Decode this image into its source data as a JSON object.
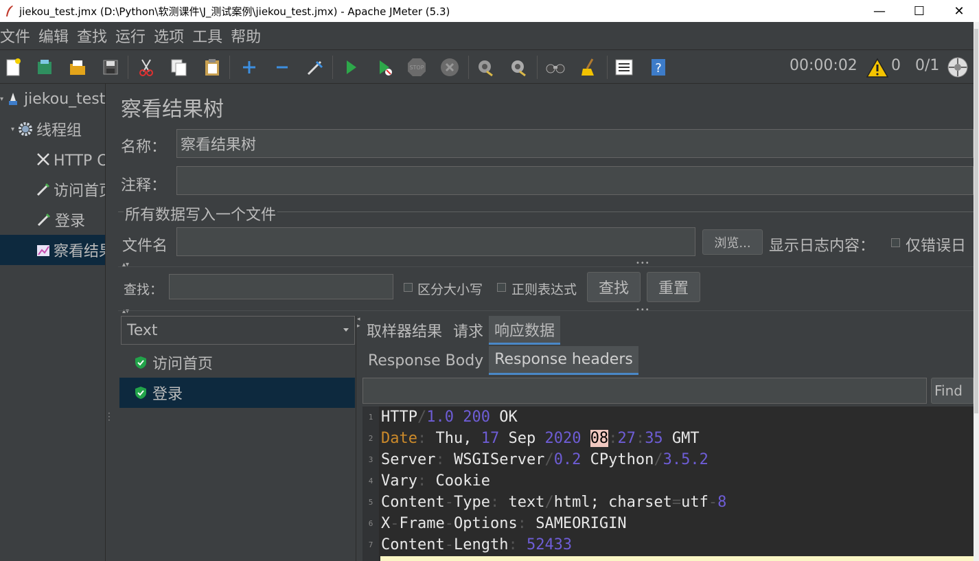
{
  "window": {
    "title": "jiekou_test.jmx (D:\\Python\\软测课件\\J_测试案例\\jiekou_test.jmx) - Apache JMeter (5.3)",
    "minimize": "—",
    "maximize": "☐",
    "close": "✕"
  },
  "menu": [
    "文件",
    "编辑",
    "查找",
    "运行",
    "选项",
    "工具",
    "帮助"
  ],
  "toolbar": {
    "timer": "00:00:02",
    "warnings": "0",
    "threads": "0/1"
  },
  "tree": [
    {
      "label": "jiekou_test",
      "icon": "test-plan-icon"
    },
    {
      "label": "线程组",
      "icon": "gear-icon"
    },
    {
      "label": "HTTP Cookie管理器",
      "icon": "config-tools-icon"
    },
    {
      "label": "访问首页",
      "icon": "sampler-pen-icon"
    },
    {
      "label": "登录",
      "icon": "sampler-pen-icon"
    },
    {
      "label": "察看结果树",
      "icon": "listener-chart-icon",
      "selected": true
    }
  ],
  "panel": {
    "title": "察看结果树",
    "name_label": "名称：",
    "name_value": "察看结果树",
    "comment_label": "注释：",
    "comment_value": "",
    "file_group_label": "所有数据写入一个文件",
    "filename_label": "文件名",
    "filename_value": "",
    "browse_button": "浏览...",
    "log_display_label": "显示日志内容：",
    "errors_only_label": "仅错误日",
    "search_label": "查找：",
    "search_value": "",
    "case_sensitive_label": "区分大小写",
    "regex_label": "正则表达式",
    "find_button": "查找",
    "reset_button": "重置"
  },
  "results": {
    "renderer": "Text",
    "items": [
      {
        "label": "访问首页",
        "status": "success"
      },
      {
        "label": "登录",
        "status": "success",
        "selected": true
      }
    ]
  },
  "tabs": [
    "取样器结果",
    "请求",
    "响应数据"
  ],
  "active_tab": "响应数据",
  "subtabs": [
    "Response Body",
    "Response headers"
  ],
  "active_subtab": "Response headers",
  "find_field_value": "",
  "find_button": "Find",
  "headers": [
    {
      "n": "1",
      "parts": [
        [
          "w",
          "HTTP"
        ],
        [
          "s",
          "/"
        ],
        [
          "p",
          "1.0 200"
        ],
        [
          "w",
          " OK"
        ]
      ]
    },
    {
      "n": "2",
      "parts": [
        [
          "o",
          "Date"
        ],
        [
          "s",
          ":"
        ],
        [
          "w",
          " Thu, "
        ],
        [
          "p",
          "17"
        ],
        [
          "w",
          " Sep "
        ],
        [
          "p",
          "2020"
        ],
        [
          "w",
          " "
        ],
        [
          "h",
          "08"
        ],
        [
          "s",
          ":"
        ],
        [
          "p",
          "27"
        ],
        [
          "s",
          ":"
        ],
        [
          "p",
          "35"
        ],
        [
          "w",
          " GMT"
        ]
      ]
    },
    {
      "n": "3",
      "parts": [
        [
          "w",
          "Server"
        ],
        [
          "s",
          ":"
        ],
        [
          "w",
          " WSGIServer"
        ],
        [
          "s",
          "/"
        ],
        [
          "p",
          "0.2"
        ],
        [
          "w",
          " CPython"
        ],
        [
          "s",
          "/"
        ],
        [
          "p",
          "3.5.2"
        ]
      ]
    },
    {
      "n": "4",
      "parts": [
        [
          "w",
          "Vary"
        ],
        [
          "s",
          ":"
        ],
        [
          "w",
          " Cookie"
        ]
      ]
    },
    {
      "n": "5",
      "parts": [
        [
          "w",
          "Content"
        ],
        [
          "s",
          "-"
        ],
        [
          "w",
          "Type"
        ],
        [
          "s",
          ":"
        ],
        [
          "w",
          " text"
        ],
        [
          "s",
          "/"
        ],
        [
          "w",
          "html; charset"
        ],
        [
          "s",
          "="
        ],
        [
          "w",
          "utf"
        ],
        [
          "s",
          "-"
        ],
        [
          "p",
          "8"
        ]
      ]
    },
    {
      "n": "6",
      "parts": [
        [
          "w",
          "X"
        ],
        [
          "s",
          "-"
        ],
        [
          "w",
          "Frame"
        ],
        [
          "s",
          "-"
        ],
        [
          "w",
          "Options"
        ],
        [
          "s",
          ":"
        ],
        [
          "w",
          " SAMEORIGIN"
        ]
      ]
    },
    {
      "n": "7",
      "parts": [
        [
          "w",
          "Content"
        ],
        [
          "s",
          "-"
        ],
        [
          "w",
          "Length"
        ],
        [
          "s",
          ":"
        ],
        [
          "p",
          " 52433"
        ]
      ]
    }
  ],
  "colors": {
    "background": "#3c3f41",
    "selection": "#0d293e",
    "editor_bg": "#2b2b2b",
    "number": "#6e5dd6",
    "key_date": "#cc8a2a",
    "highlight": "#f0c8c0"
  }
}
